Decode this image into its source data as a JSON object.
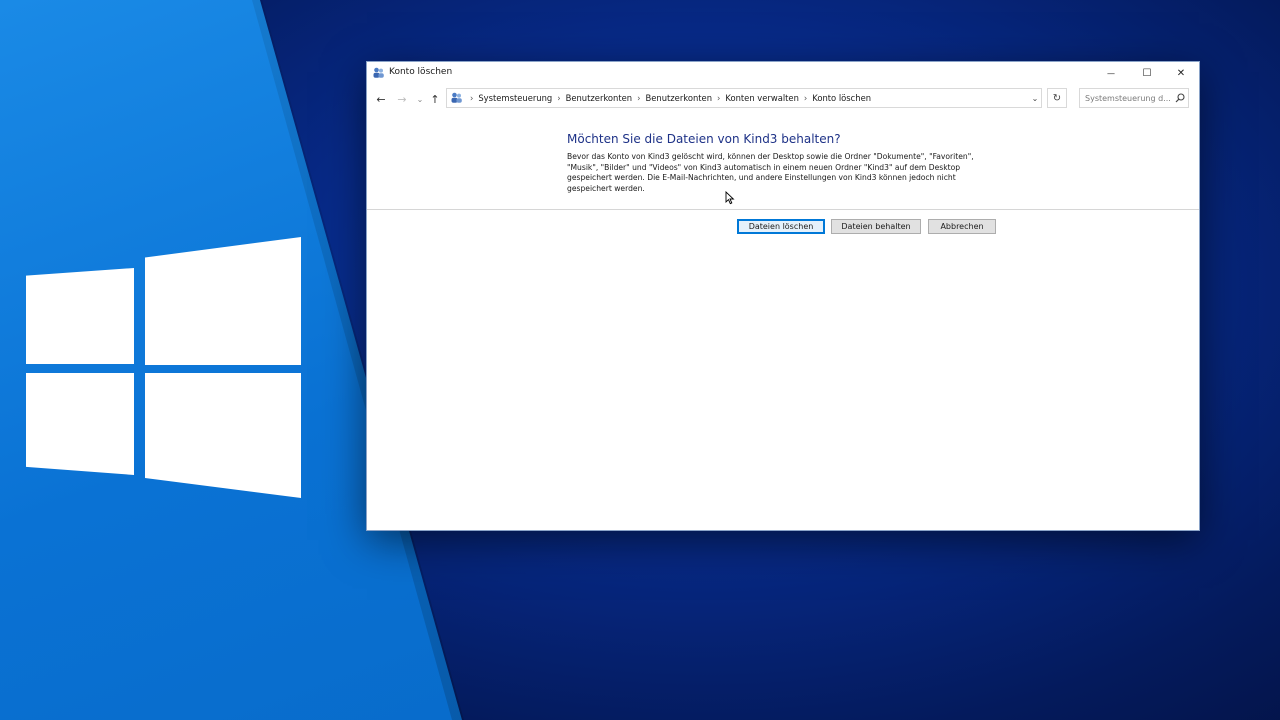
{
  "window": {
    "title": "Konto löschen",
    "controls": {
      "minimize": "—",
      "maximize": "☐",
      "close": "✕"
    }
  },
  "nav": {
    "back": "←",
    "forward": "→",
    "recent": "⌄",
    "up": "↑",
    "breadcrumb_sep": "›",
    "breadcrumbs": [
      "Systemsteuerung",
      "Benutzerkonten",
      "Benutzerkonten",
      "Konten verwalten",
      "Konto löschen"
    ],
    "dropdown": "⌄",
    "refresh": "↻",
    "search_placeholder": "Systemsteuerung d..."
  },
  "content": {
    "heading": "Möchten Sie die Dateien von Kind3 behalten?",
    "body": "Bevor das Konto von Kind3 gelöscht wird, können der Desktop sowie die Ordner \"Dokumente\", \"Favoriten\", \"Musik\", \"Bilder\" und \"Videos\" von Kind3 automatisch in einem neuen Ordner \"Kind3\" auf dem Desktop gespeichert werden. Die E-Mail-Nachrichten, und andere Einstellungen von Kind3 können jedoch nicht gespeichert werden."
  },
  "buttons": {
    "delete_files": "Dateien löschen",
    "keep_files": "Dateien behalten",
    "cancel": "Abbrechen"
  },
  "colors": {
    "accent": "#0078d7",
    "heading": "#1e3287",
    "desktop_dark": "#041a5c",
    "desktop_blue": "#0a72d4"
  },
  "icons": {
    "title": "users-icon",
    "address": "users-icon",
    "search": "search-icon",
    "logo": "windows-logo"
  }
}
